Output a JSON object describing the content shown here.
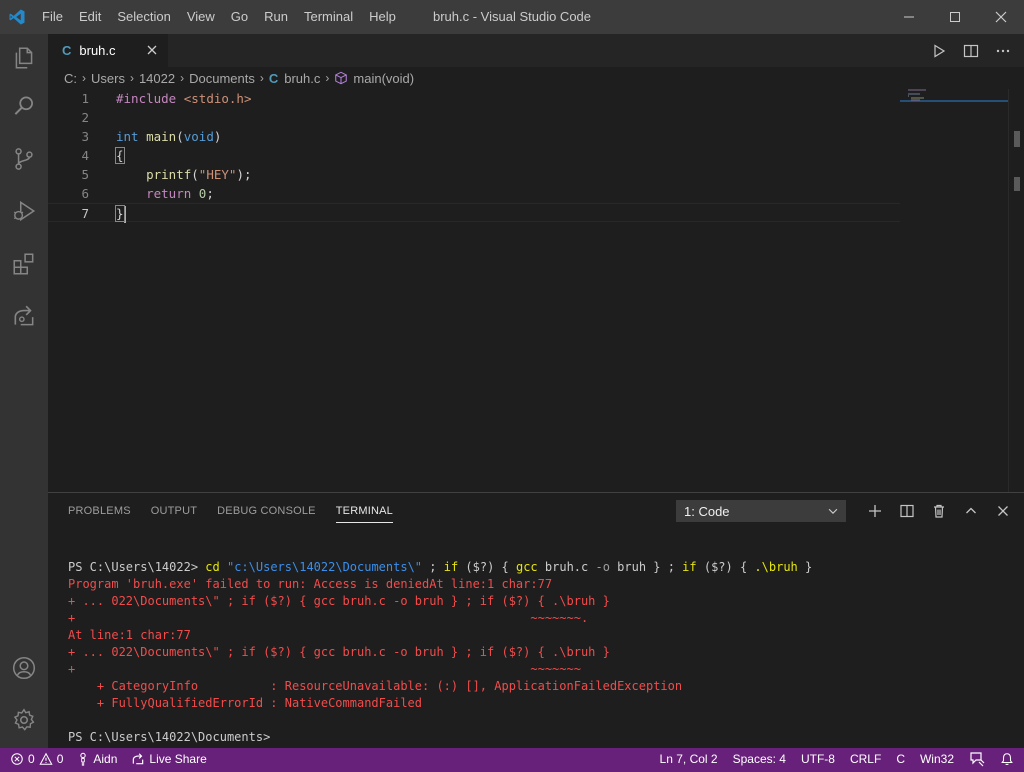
{
  "window": {
    "title": "bruh.c - Visual Studio Code",
    "menu": [
      "File",
      "Edit",
      "Selection",
      "View",
      "Go",
      "Run",
      "Terminal",
      "Help"
    ]
  },
  "colors": {
    "titlebar": "#3c3c3c",
    "activitybar": "#333333",
    "editor_bg": "#1e1e1e",
    "statusbar": "#68217a",
    "terminal_error": "#f14c4c"
  },
  "activitybar": {
    "items": [
      "explorer-icon",
      "search-icon",
      "source-control-icon",
      "run-debug-icon",
      "extensions-icon",
      "live-share-icon"
    ],
    "bottom": [
      "accounts-icon",
      "settings-gear-icon"
    ]
  },
  "tab": {
    "icon": "C",
    "name": "bruh.c"
  },
  "breadcrumb": {
    "drive": "C:",
    "folders": [
      "Users",
      "14022",
      "Documents"
    ],
    "file_icon": "C",
    "file": "bruh.c",
    "symbol": "main(void)"
  },
  "editor": {
    "line_numbers": [
      "1",
      "2",
      "3",
      "4",
      "5",
      "6",
      "7"
    ],
    "lines": [
      {
        "directive": "#include",
        "include": "<stdio.h>"
      },
      {},
      {
        "type": "int",
        "fn": "main",
        "open": "(",
        "param": "void",
        "close": ")"
      },
      {
        "brace": "{"
      },
      {
        "indent": "    ",
        "fn": "printf",
        "open": "(",
        "str": "\"HEY\"",
        "close": ");"
      },
      {
        "indent": "    ",
        "kw": "return",
        "space": " ",
        "num": "0",
        "end": ";"
      },
      {
        "brace": "}"
      }
    ]
  },
  "panel": {
    "tabs": [
      "PROBLEMS",
      "OUTPUT",
      "DEBUG CONSOLE",
      "TERMINAL"
    ],
    "active_tab": "TERMINAL",
    "terminal_select": "1: Code"
  },
  "terminal": {
    "cmd_prompt": "PS C:\\Users\\14022> ",
    "cmd_cd": "cd ",
    "cmd_path": "\"c:\\Users\\14022\\Documents\\\"",
    "cmd_sep1": " ; ",
    "cmd_if1": "if",
    "cmd_cond1": " ($?) { ",
    "cmd_gcc": "gcc",
    "cmd_gcc_args1": " bruh.c ",
    "cmd_gcc_flag": "-o",
    "cmd_gcc_args2": " bruh } ; ",
    "cmd_if2": "if",
    "cmd_cond2": " ($?) { ",
    "cmd_run": ".\\bruh",
    "cmd_end": " }",
    "error_lines": [
      "Program 'bruh.exe' failed to run: Access is deniedAt line:1 char:77",
      "+ ... 022\\Documents\\\" ; if ($?) { gcc bruh.c -o bruh } ; if ($?) { .\\bruh }",
      "+                                                               ~~~~~~~.",
      "At line:1 char:77",
      "+ ... 022\\Documents\\\" ; if ($?) { gcc bruh.c -o bruh } ; if ($?) { .\\bruh }",
      "+                                                               ~~~~~~~",
      "    + CategoryInfo          : ResourceUnavailable: (:) [], ApplicationFailedException",
      "    + FullyQualifiedErrorId : NativeCommandFailed"
    ],
    "final_prompt": "PS C:\\Users\\14022\\Documents>"
  },
  "statusbar": {
    "errors": "0",
    "warnings": "0",
    "user": "Aidn",
    "live_share": "Live Share",
    "position": "Ln 7, Col 2",
    "spaces": "Spaces: 4",
    "encoding": "UTF-8",
    "eol": "CRLF",
    "language": "C",
    "platform": "Win32"
  }
}
